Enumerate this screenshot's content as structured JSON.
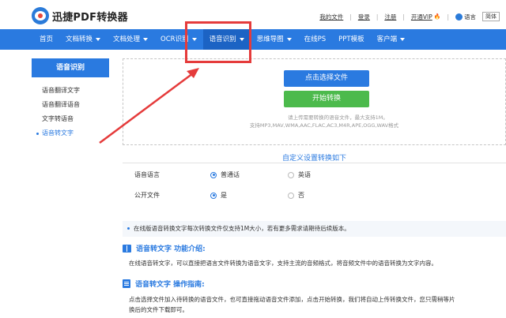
{
  "header": {
    "app_title": "迅捷PDF转换器",
    "links": [
      "我的文件",
      "登录",
      "注册",
      "开通VIP"
    ],
    "vip_badge": "🔥",
    "lang_label": "语言",
    "lang_value": "简体"
  },
  "nav": {
    "items": [
      {
        "label": "首页",
        "has_caret": false
      },
      {
        "label": "文档转换",
        "has_caret": true
      },
      {
        "label": "文档处理",
        "has_caret": true
      },
      {
        "label": "OCR识别",
        "has_caret": true
      },
      {
        "label": "语音识别",
        "has_caret": true
      },
      {
        "label": "思维导图",
        "has_caret": true
      },
      {
        "label": "在线PS",
        "has_caret": false
      },
      {
        "label": "PPT模板",
        "has_caret": false
      },
      {
        "label": "客户端",
        "has_caret": true
      }
    ]
  },
  "sidebar": {
    "title": "语音识别",
    "items": [
      {
        "label": "语音翻译文字",
        "active": false
      },
      {
        "label": "语音翻译语音",
        "active": false
      },
      {
        "label": "文字转语音",
        "active": false
      },
      {
        "label": "语音转文字",
        "active": true
      }
    ]
  },
  "upload": {
    "select_label": "点击选择文件",
    "start_label": "开始转换",
    "hint_line1": "请上传需要转换的语音文件，最大支持1M。",
    "hint_line2": "支持MP3,MAV,WMA,AAC,FLAC,AC3,M4R,APE,OGG,WAV格式"
  },
  "settings": {
    "title": "自定义设置转换如下",
    "language_label": "语音语言",
    "language_options": [
      "普通话",
      "英语"
    ],
    "language_selected": "普通话",
    "public_label": "公开文件",
    "public_options": [
      "是",
      "否"
    ],
    "public_selected": "是"
  },
  "notice": "在线版语音转换文字每次转换文件仅支持1M大小，若有更多需求请期待后续版本。",
  "intro": {
    "title": "语音转文字 功能介绍:",
    "text": "在线语音转文字，可以直接把语言文件转换为语音文字，支持主流的音频格式，将音频文件中的语音转换为文字内容。"
  },
  "guide": {
    "title": "语音转文字 操作指南:",
    "text_line1": "点击选择文件加入待转换的语音文件，也可直接拖动语音文件添加，点击开始转换，我们将自动上传转换文件，您只需稍等片",
    "text_line2": "换后的文件下载即可。"
  },
  "colors": {
    "primary": "#2a7ae0",
    "green": "#4cba4c",
    "annotation_red": "#e53b3b"
  }
}
